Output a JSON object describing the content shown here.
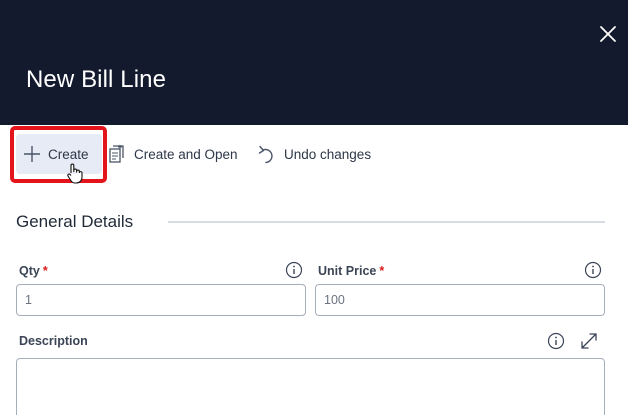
{
  "dialog": {
    "title": "New Bill Line"
  },
  "toolbar": {
    "create_label": "Create",
    "create_open_label": "Create and Open",
    "undo_label": "Undo changes"
  },
  "section": {
    "title": "General Details"
  },
  "fields": {
    "qty": {
      "label": "Qty",
      "required": "*",
      "value": "1"
    },
    "unit_price": {
      "label": "Unit Price",
      "required": "*",
      "value": "100"
    },
    "description": {
      "label": "Description",
      "value": ""
    }
  },
  "icons": {
    "close": "close-icon",
    "create": "plus-icon",
    "create_open": "create-open-icon",
    "undo": "undo-icon",
    "info": "info-icon",
    "expand": "expand-icon"
  },
  "colors": {
    "header_bg": "#131a2e",
    "create_bg": "#e7ebf5",
    "highlight": "#e3141b",
    "required": "#d81b1b"
  }
}
